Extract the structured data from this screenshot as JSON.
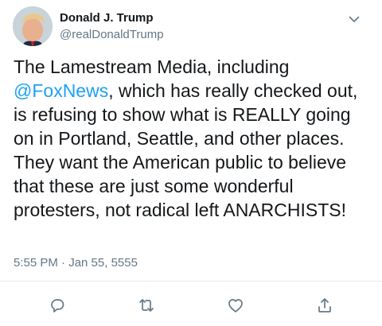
{
  "author": {
    "display_name": "Donald J. Trump",
    "handle": "@realDonaldTrump"
  },
  "tweet": {
    "text_before_mention": "The Lamestream Media, including ",
    "mention": "@FoxNews",
    "text_after_mention": ", which has really checked out, is refusing to show what is REALLY going on in Portland, Seattle, and other places. They want the American public to believe that these are just some wonderful protesters, not radical left ANARCHISTS!",
    "timestamp": "5:55 PM · Jan 55, 5555"
  },
  "icons": {
    "menu": "chevron-down-icon",
    "reply": "reply-icon",
    "retweet": "retweet-icon",
    "like": "heart-icon",
    "share": "share-icon"
  },
  "colors": {
    "text": "#14171a",
    "secondary": "#657786",
    "link": "#1da1f2",
    "icon": "#657786"
  }
}
